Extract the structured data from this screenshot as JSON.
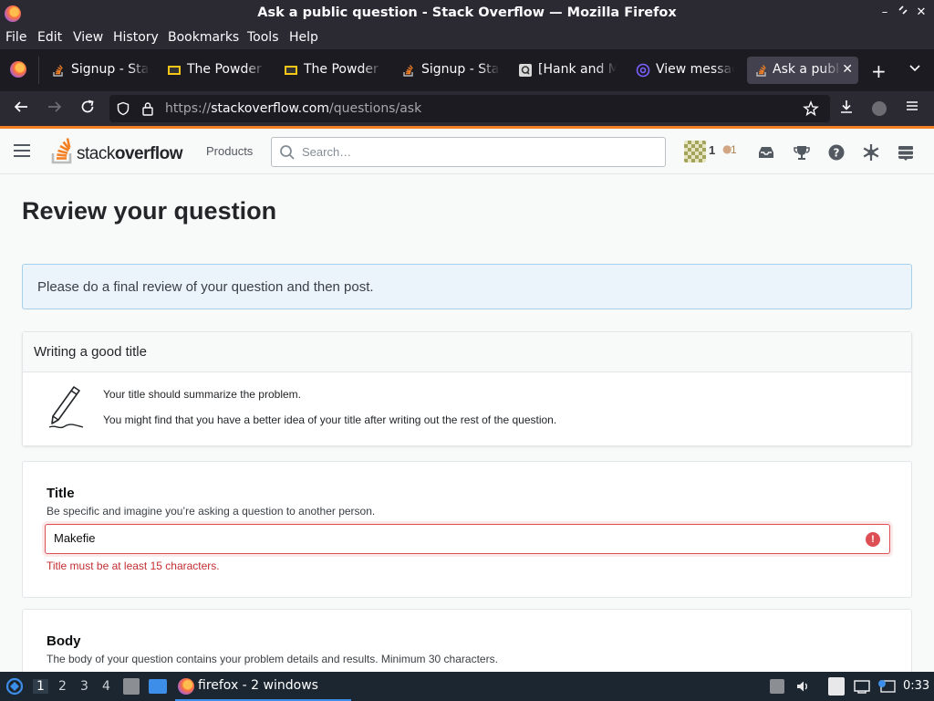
{
  "window": {
    "title": "Ask a public question - Stack Overflow — Mozilla Firefox"
  },
  "menubar": {
    "items": [
      "File",
      "Edit",
      "View",
      "History",
      "Bookmarks",
      "Tools",
      "Help"
    ]
  },
  "tabs": [
    {
      "label": "Signup - Stac",
      "icon": "stackoverflow-icon",
      "active": false
    },
    {
      "label": "The Powder T",
      "icon": "film-icon",
      "active": false
    },
    {
      "label": "The Powder T",
      "icon": "film-icon",
      "active": false
    },
    {
      "label": "Signup - Stac",
      "icon": "stackoverflow-icon",
      "active": false
    },
    {
      "label": "[Hank and M",
      "icon": "q-icon",
      "active": false
    },
    {
      "label": "View messag",
      "icon": "at-icon",
      "active": false
    },
    {
      "label": "Ask a publ",
      "icon": "stackoverflow-icon",
      "active": true
    }
  ],
  "navbar": {
    "url_prefix": "https://",
    "url_host": "stackoverflow.com",
    "url_path": "/questions/ask"
  },
  "so_header": {
    "logo_text_1": "stack",
    "logo_text_2": "overflow",
    "products": "Products",
    "search_placeholder": "Search…",
    "reputation": "1",
    "bronze_badges": "1"
  },
  "page": {
    "title": "Review your question",
    "notice": "Please do a final review of your question and then post.",
    "tip": {
      "heading": "Writing a good title",
      "line1": "Your title should summarize the problem.",
      "line2": "You might find that you have a better idea of your title after writing out the rest of the question."
    },
    "title_field": {
      "label": "Title",
      "description": "Be specific and imagine you’re asking a question to another person.",
      "value": "Makefie",
      "error": "Title must be at least 15 characters."
    },
    "body_field": {
      "label": "Body",
      "description": "The body of your question contains your problem details and results. Minimum 30 characters."
    }
  },
  "taskbar": {
    "workspaces": [
      "1",
      "2",
      "3",
      "4"
    ],
    "task_label": "firefox - 2 windows",
    "clock": "0:33"
  },
  "colors": {
    "so_orange": "#f48024",
    "error_red": "#de4f54",
    "notice_bg": "#ebf4fb"
  }
}
